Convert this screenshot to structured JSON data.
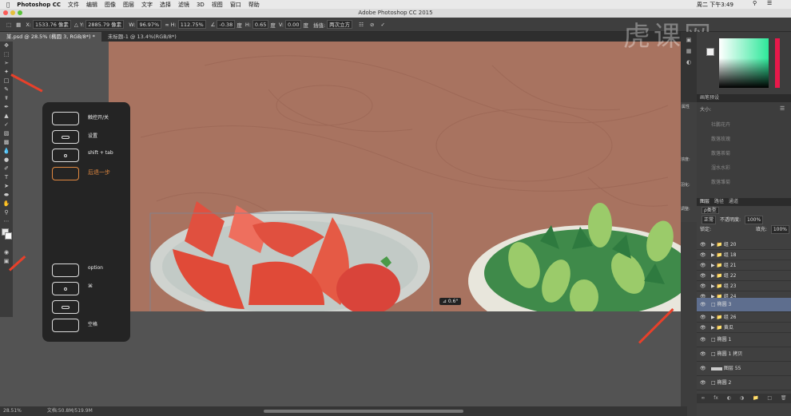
{
  "menubar": {
    "app": "Photoshop CC",
    "items": [
      "文件",
      "编辑",
      "图像",
      "图层",
      "文字",
      "选择",
      "滤镜",
      "3D",
      "视图",
      "窗口",
      "帮助"
    ],
    "time": "周二 下午3:49"
  },
  "titlebar": {
    "title": "Adobe Photoshop CC 2015"
  },
  "options": {
    "x_label": "X:",
    "x_value": "1533.76 像素",
    "y_label": "Y:",
    "y_value": "2885.79 像素",
    "w_label": "W:",
    "w_value": "96.97%",
    "h_label": "H:",
    "h_value": "112.75%",
    "angle_value": "-0.38",
    "angle_unit": "度",
    "hskew_label": "H:",
    "hskew_value": "0.65",
    "hskew_unit": "度",
    "vskew_label": "V:",
    "vskew_value": "0.00",
    "vskew_unit": "度",
    "interp_label": "插值:",
    "interp_value": "两次立方"
  },
  "tabs": [
    {
      "label": "某.psd @ 28.5% (椭圆 3, RGB/8*) *"
    },
    {
      "label": "未标题-1 @ 13.4%(RGB/8*)"
    }
  ],
  "overlay": {
    "keys": [
      {
        "label": "触控开/关"
      },
      {
        "label": "设置"
      },
      {
        "label": "shift + tab"
      },
      {
        "label": "后退一步"
      },
      {
        "label": "option"
      },
      {
        "label": "⌘"
      },
      {
        "label": ""
      },
      {
        "label": "空格"
      }
    ]
  },
  "canvas": {
    "rotation_badge": "⊿ 0.6°"
  },
  "watermark": "虎课网",
  "panels": {
    "brush_presets_title": "画笔预设",
    "size_label": "大小:",
    "brushes": [
      "社鹏花卉",
      "散落玫瑰",
      "散落茶菊",
      "湿水水彩",
      "散落雏菊"
    ],
    "properties_tab": "属性",
    "density_label": "浓度:",
    "feather_label": "羽化:",
    "adjust_label": "调整:",
    "layers_tabs": [
      "图层",
      "路径",
      "通道"
    ],
    "kind_label": "ρ类型",
    "blend_mode": "正常",
    "opacity_label": "不透明度:",
    "opacity_value": "100%",
    "lock_label": "锁定:",
    "fill_label": "填充:",
    "fill_value": "100%",
    "layers": [
      {
        "name": "组 20",
        "type": "group"
      },
      {
        "name": "组 18",
        "type": "group"
      },
      {
        "name": "组 21",
        "type": "group"
      },
      {
        "name": "组 22",
        "type": "group"
      },
      {
        "name": "组 23",
        "type": "group"
      },
      {
        "name": "组 24",
        "type": "group"
      },
      {
        "name": "椭圆 3",
        "type": "shape",
        "selected": true
      },
      {
        "name": "组 26",
        "type": "group"
      },
      {
        "name": "黄瓜",
        "type": "group"
      },
      {
        "name": "椭圆 1",
        "type": "shape"
      },
      {
        "name": "椭圆 1 拷贝",
        "type": "shape"
      },
      {
        "name": "图层 55",
        "type": "pixel"
      },
      {
        "name": "椭圆 2",
        "type": "shape"
      }
    ]
  },
  "status": {
    "zoom": "28.51%",
    "doc": "文档:50.8M/519.9M"
  },
  "colors": {
    "canvas_bg": "#a87360",
    "accent_orange": "#e08840",
    "selected_layer": "#5e6e8e",
    "arrow": "#e8402a"
  }
}
